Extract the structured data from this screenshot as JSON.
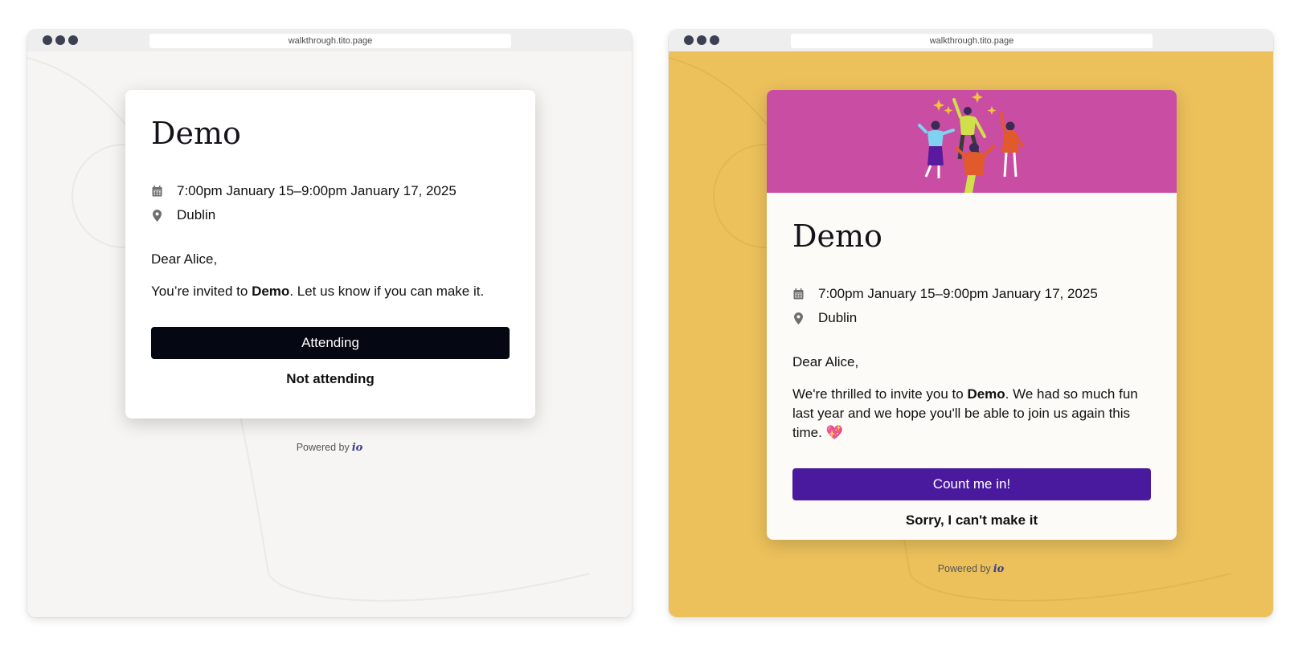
{
  "left": {
    "url": "walkthrough.tito.page",
    "event_title": "Demo",
    "date_range": "7:00pm January 15–9:00pm January 17, 2025",
    "location": "Dublin",
    "greeting": "Dear Alice,",
    "message_prefix": "You’re invited to ",
    "message_bold": "Demo",
    "message_suffix": ". Let us know if you can make it.",
    "primary_label": "Attending",
    "secondary_label": "Not attending",
    "powered_by": "Powered by",
    "logo_text": "io",
    "colors": {
      "page_bg": "#f6f5f3",
      "primary": "#050712"
    }
  },
  "right": {
    "url": "walkthrough.tito.page",
    "event_title": "Demo",
    "date_range": "7:00pm January 15–9:00pm January 17, 2025",
    "location": "Dublin",
    "greeting": "Dear Alice,",
    "message_prefix": "We're thrilled to invite you to ",
    "message_bold": "Demo",
    "message_suffix": ". We had so much fun last year and we hope you'll be able to join us again this time. 💖",
    "primary_label": "Count me in!",
    "secondary_label": "Sorry, I can't make it",
    "powered_by": "Powered by",
    "logo_text": "io",
    "colors": {
      "page_bg": "#ecc15c",
      "banner": "#c94ea3",
      "primary": "#4a1a9e"
    }
  }
}
